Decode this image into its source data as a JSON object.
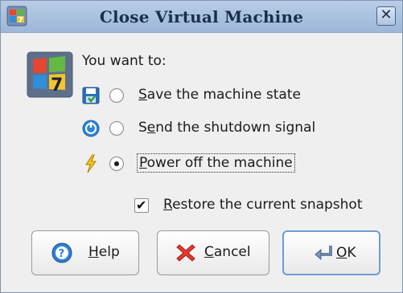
{
  "window": {
    "title": "Close Virtual Machine",
    "close_label": "✕"
  },
  "dialog": {
    "prompt": "You want to:",
    "options": [
      {
        "label_mnemonic": "S",
        "label_rest": "ave the machine state",
        "icon": "save-state-icon",
        "selected": false
      },
      {
        "label_before": "S",
        "label_mnemonic": "e",
        "label_rest": "nd the shutdown signal",
        "icon": "shutdown-signal-icon",
        "selected": false
      },
      {
        "label_mnemonic": "P",
        "label_rest": "ower off the machine",
        "icon": "power-off-icon",
        "selected": true
      }
    ],
    "snapshot": {
      "label_mnemonic": "R",
      "label_rest": "estore the current snapshot",
      "checked": true,
      "check_glyph": "✔"
    }
  },
  "buttons": {
    "help": {
      "mnemonic": "H",
      "rest": "elp",
      "icon": "help-icon"
    },
    "cancel": {
      "mnemonic": "C",
      "rest": "ancel",
      "icon": "cancel-icon"
    },
    "ok": {
      "mnemonic": "O",
      "rest": "K",
      "icon": "ok-icon"
    }
  },
  "colors": {
    "titlebar": "#9db7d8",
    "window_bg": "#efefef",
    "default_button_border": "#6f9bd1"
  }
}
